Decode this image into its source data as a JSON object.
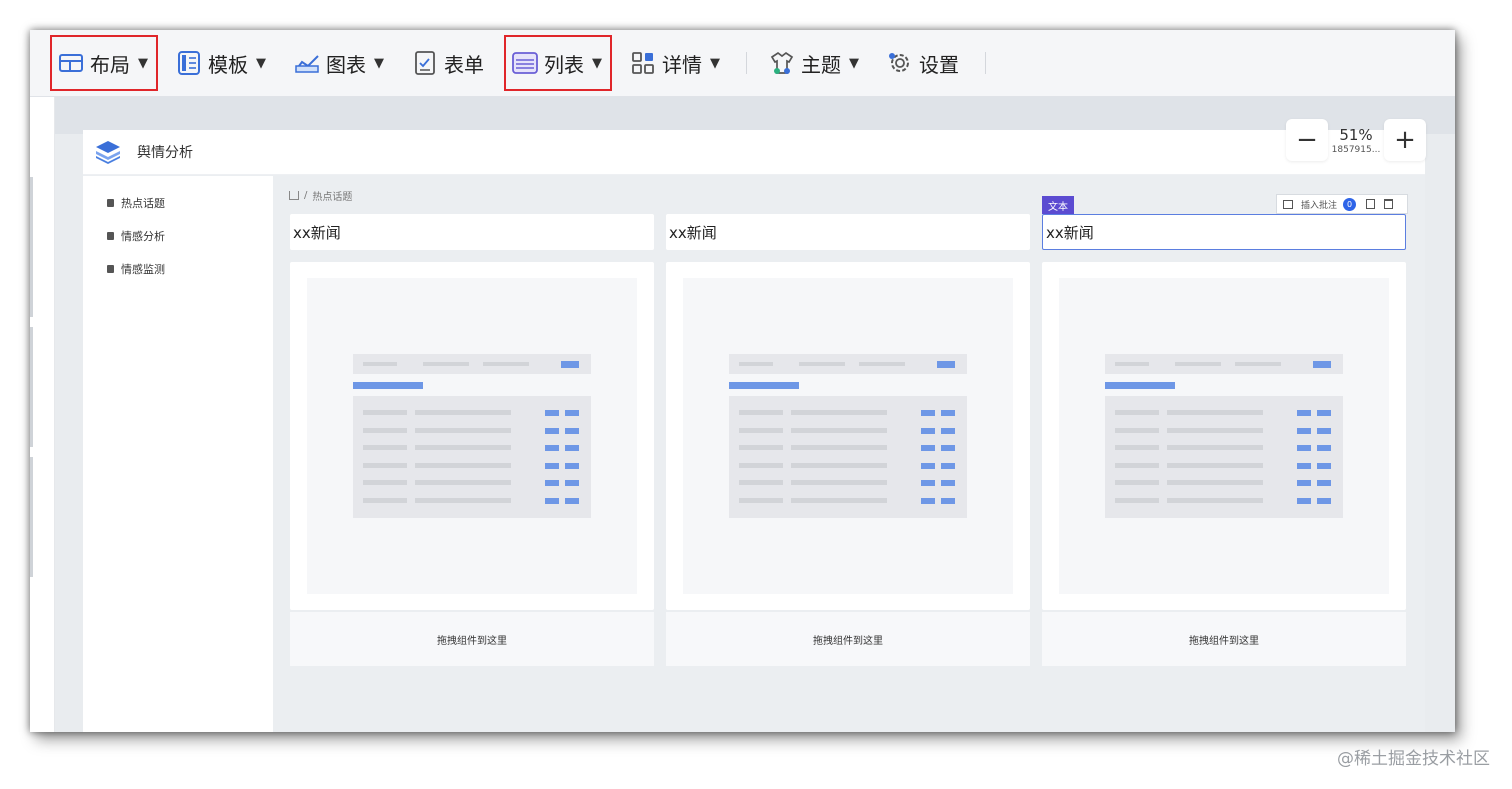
{
  "toolbar": {
    "items": [
      {
        "label": "布局",
        "icon": "layout-icon",
        "caret": true
      },
      {
        "label": "模板",
        "icon": "template-icon",
        "caret": true
      },
      {
        "label": "图表",
        "icon": "chart-icon",
        "caret": true
      },
      {
        "label": "表单",
        "icon": "form-icon",
        "caret": false
      },
      {
        "label": "列表",
        "icon": "list-icon",
        "caret": true
      },
      {
        "label": "详情",
        "icon": "detail-icon",
        "caret": true
      },
      {
        "label": "主题",
        "icon": "theme-icon",
        "caret": true
      },
      {
        "label": "设置",
        "icon": "settings-icon",
        "caret": false
      }
    ],
    "highlight_color": "#e0262a"
  },
  "app": {
    "title": "舆情分析",
    "nav": [
      "热点话题",
      "情感分析",
      "情感监测"
    ],
    "breadcrumb": "热点话题"
  },
  "zoom": {
    "minus": "−",
    "plus": "+",
    "percent": "51%",
    "number": "1857915..."
  },
  "columns": [
    {
      "text": "xx新闻",
      "drop_hint": "拖拽组件到这里"
    },
    {
      "text": "xx新闻",
      "drop_hint": "拖拽组件到这里"
    },
    {
      "text": "xx新闻",
      "drop_hint": "拖拽组件到这里"
    }
  ],
  "selection": {
    "badge": "文本",
    "comment_label": "插入批注",
    "comment_count": "0"
  },
  "watermark": "@稀土掘金技术社区",
  "colors": {
    "accent": "#5b7ee0",
    "badge": "#5b4bd1",
    "placeholder_blue": "#6e97e6"
  }
}
